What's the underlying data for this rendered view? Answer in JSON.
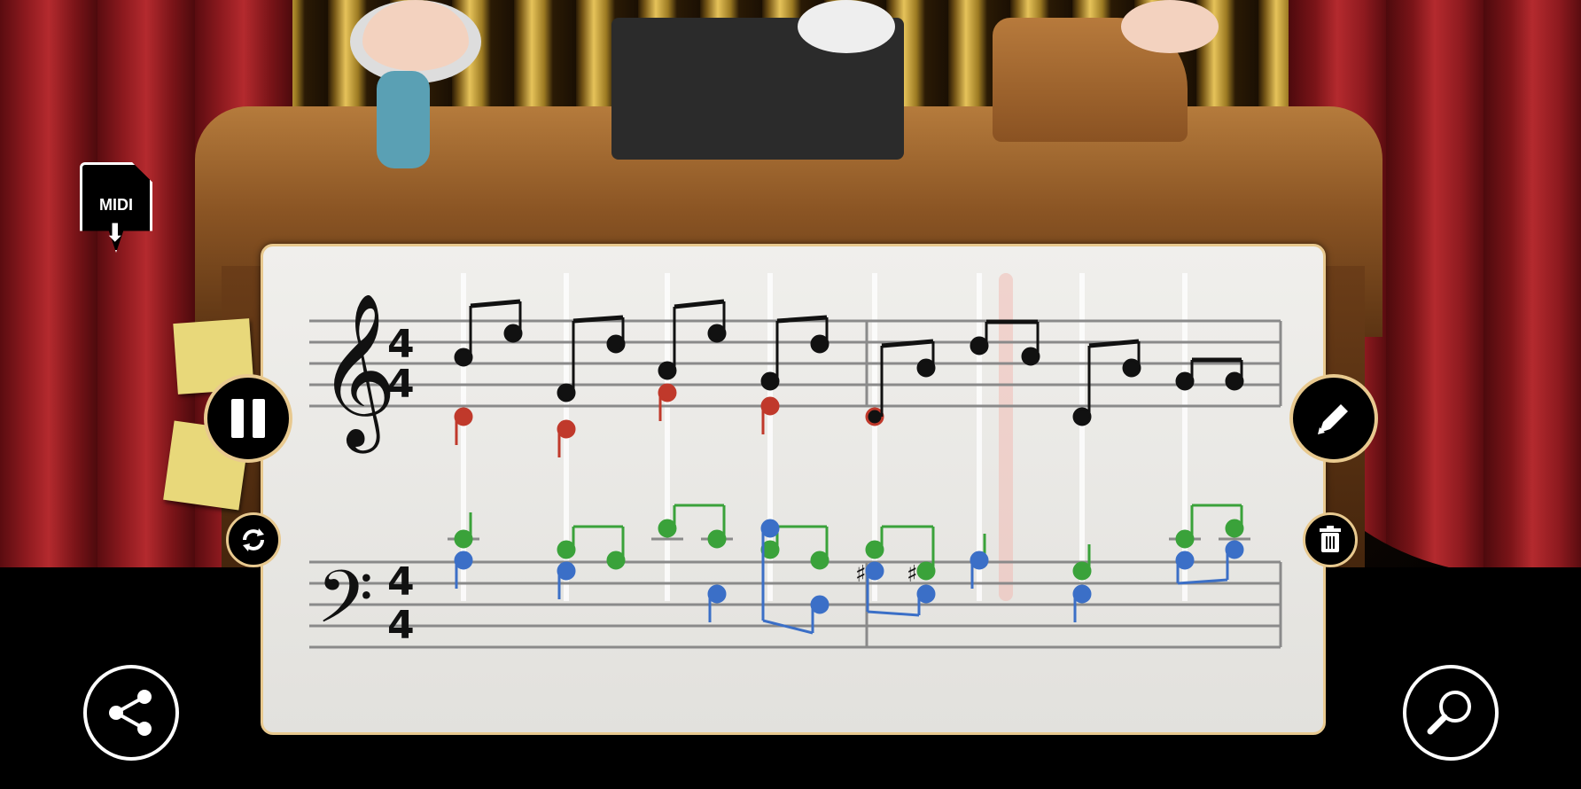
{
  "app": {
    "midi_button": {
      "label": "MIDI"
    },
    "controls": {
      "pause": "pause",
      "edit": "edit",
      "loop": "loop",
      "delete": "delete",
      "share": "share",
      "zoom": "zoom"
    },
    "score": {
      "treble_time_signature": {
        "top": "4",
        "bottom": "4"
      },
      "bass_time_signature": {
        "top": "4",
        "bottom": "4"
      },
      "accidentals": [
        "♯",
        "♯"
      ]
    },
    "colors": {
      "melody": "#000000",
      "voice_red": "#c0392b",
      "voice_green": "#3aa23a",
      "voice_blue": "#3b6fc7",
      "panel_border": "#e8c98f"
    },
    "icons": [
      "midi-download-icon",
      "pause-icon",
      "pencil-icon",
      "loop-icon",
      "trash-icon",
      "share-icon",
      "magnifier-icon",
      "treble-clef-icon",
      "bass-clef-icon"
    ]
  }
}
